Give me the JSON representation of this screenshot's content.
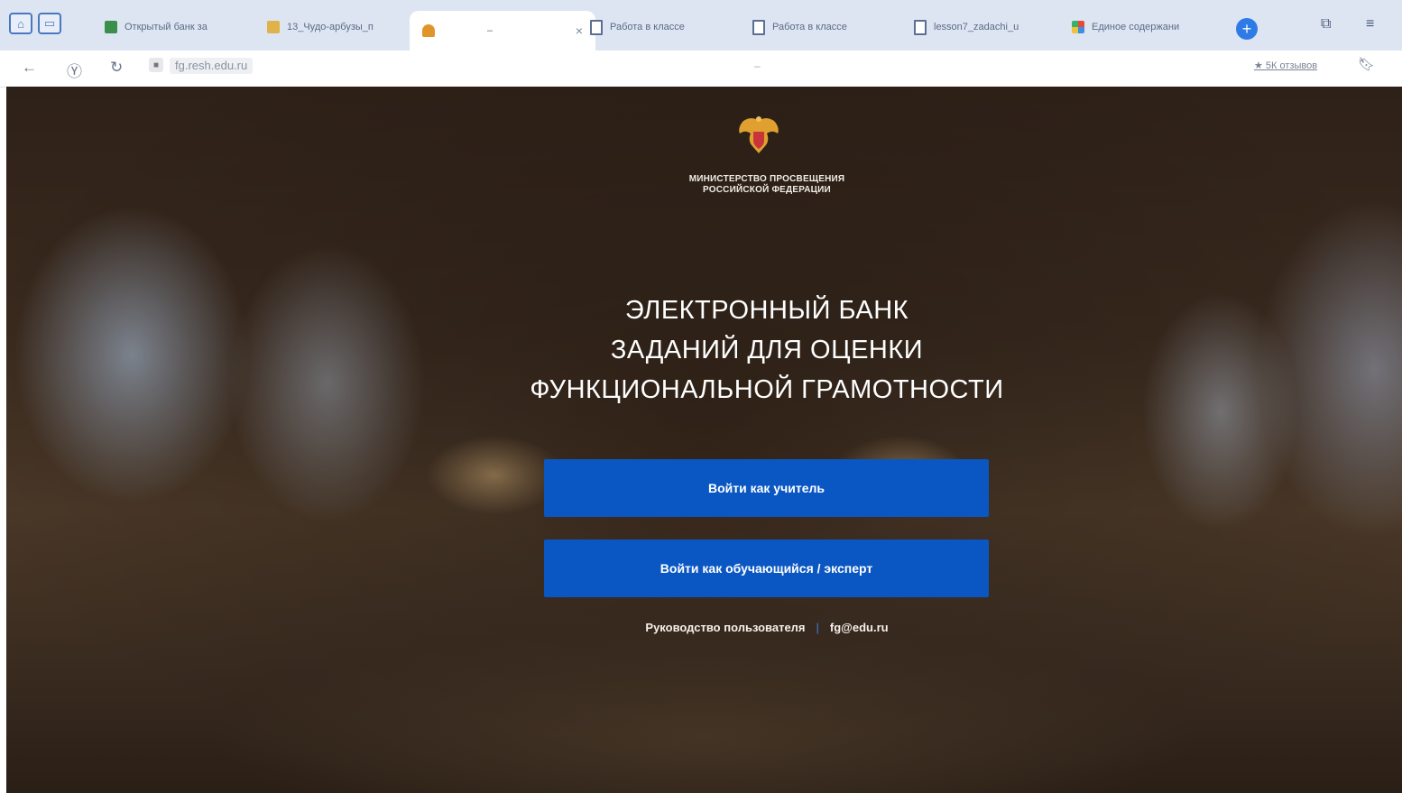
{
  "browser": {
    "tabs": [
      {
        "label": "Открытый банк за",
        "favicon": "edu-favicon"
      },
      {
        "label": "13_Чудо-арбузы_п",
        "favicon": "doc-favicon"
      },
      {
        "label": "–",
        "favicon": "emblem-favicon",
        "active": true
      },
      {
        "label": "Работа в классе",
        "favicon": "page-icon"
      },
      {
        "label": "Работа в классе",
        "favicon": "page-icon"
      },
      {
        "label": "lesson7_zadachi_u",
        "favicon": "page-icon"
      },
      {
        "label": "Единое содержани",
        "favicon": "colorful-favicon"
      }
    ],
    "tab_close": "×",
    "new_tab": "+",
    "address": {
      "url": "fg.resh.edu.ru",
      "center_text": "–",
      "reviews": "★ 5К отзывов"
    },
    "colors": {
      "tabbar_bg": "#dde5f2",
      "accent": "#2f7be6"
    }
  },
  "page": {
    "ministry": {
      "line1": "МИНИСТЕРСТВО ПРОСВЕЩЕНИЯ",
      "line2": "РОССИЙСКОЙ ФЕДЕРАЦИИ"
    },
    "title": {
      "line1": "ЭЛЕКТРОННЫЙ БАНК",
      "line2": "ЗАДАНИЙ ДЛЯ ОЦЕНКИ",
      "line3": "ФУНКЦИОНАЛЬНОЙ ГРАМОТНОСТИ"
    },
    "buttons": {
      "teacher": "Войти как учитель",
      "student": "Войти как обучающийся / эксперт"
    },
    "links": {
      "manual": "Руководство пользователя",
      "separator": "|",
      "email": "fg@edu.ru"
    },
    "colors": {
      "button_bg": "#0a57c4",
      "text": "#ffffff"
    }
  }
}
